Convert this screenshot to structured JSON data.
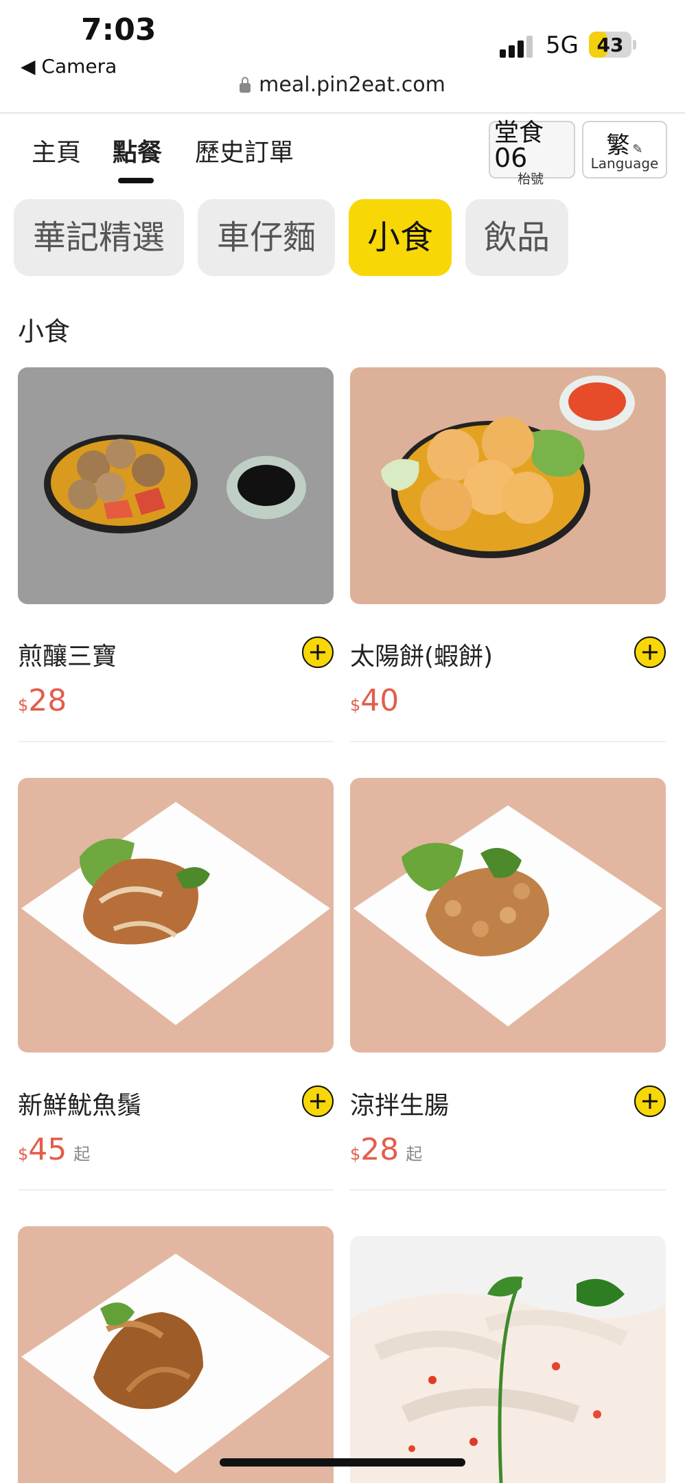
{
  "status_bar": {
    "time": "7:03",
    "back_label": "◀ Camera",
    "network": "5G",
    "battery_percent": 43,
    "battery_label": "43",
    "url": "meal.pin2eat.com"
  },
  "nav": {
    "items": [
      {
        "label": "主頁"
      },
      {
        "label": "點餐",
        "active": true
      },
      {
        "label": "歷史訂單"
      }
    ],
    "table": {
      "mode": "堂食",
      "number": "06",
      "label": "枱號"
    },
    "language": {
      "current": "繁",
      "label": "Language"
    }
  },
  "categories": [
    {
      "label": "華記精選",
      "active": false
    },
    {
      "label": "車仔麵",
      "active": false
    },
    {
      "label": "小食",
      "active": true
    },
    {
      "label": "飲品",
      "active": false
    }
  ],
  "section_title": "小食",
  "items": [
    {
      "name": "煎釀三寶",
      "currency": "$",
      "price": "28",
      "suffix": ""
    },
    {
      "name": "太陽餅(蝦餅)",
      "currency": "$",
      "price": "40",
      "suffix": ""
    },
    {
      "name": "新鮮魷魚鬚",
      "currency": "$",
      "price": "45",
      "suffix": "起"
    },
    {
      "name": "涼拌生腸",
      "currency": "$",
      "price": "28",
      "suffix": "起"
    },
    {
      "name": "",
      "currency": "",
      "price": "",
      "suffix": ""
    },
    {
      "name": "",
      "currency": "",
      "price": "",
      "suffix": ""
    }
  ],
  "colors": {
    "accent": "#f8d706",
    "price": "#e35d4a",
    "chip": "#ececec"
  }
}
